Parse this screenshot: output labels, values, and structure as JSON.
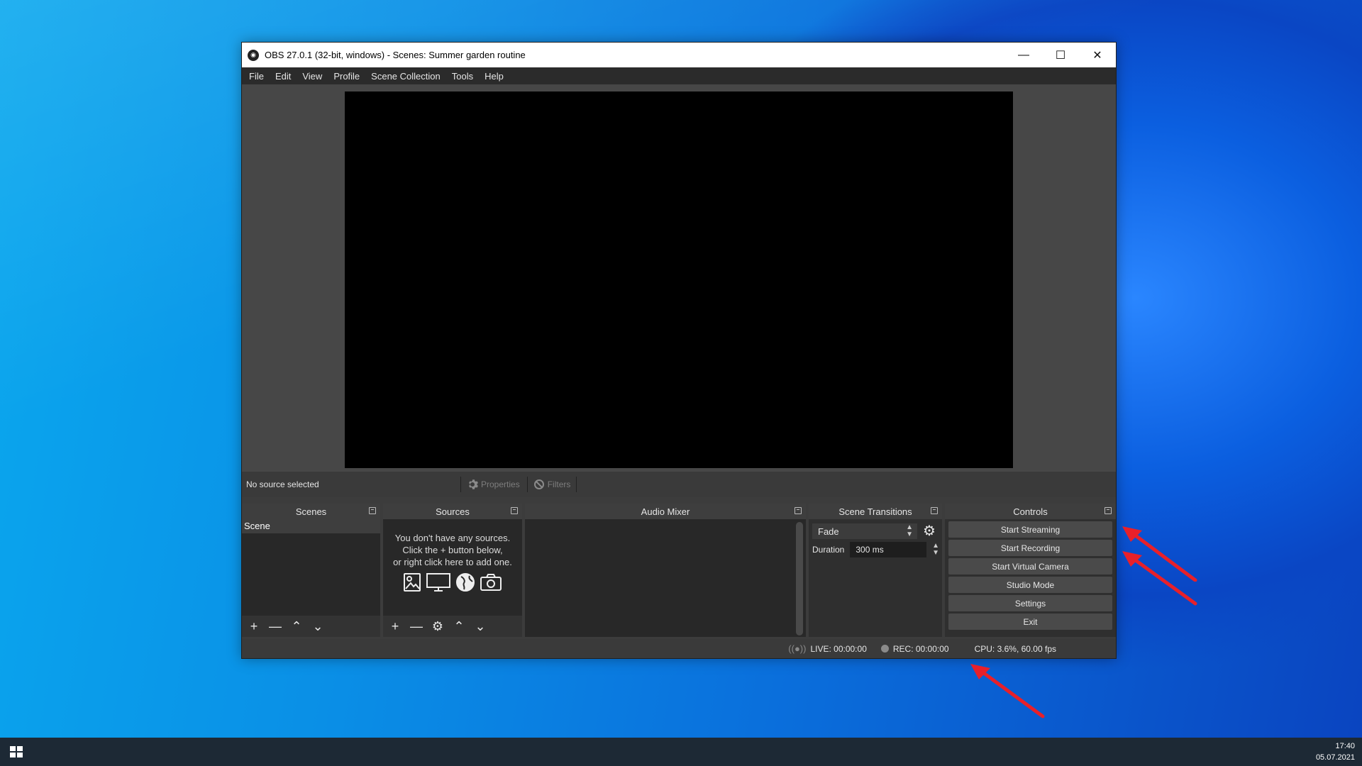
{
  "window": {
    "title": "OBS 27.0.1 (32-bit, windows) - Scenes: Summer garden routine",
    "icon": "obs-logo-icon"
  },
  "menu": [
    "File",
    "Edit",
    "View",
    "Profile",
    "Scene Collection",
    "Tools",
    "Help"
  ],
  "source_bar": {
    "status": "No source selected",
    "properties_label": "Properties",
    "filters_label": "Filters"
  },
  "docks": {
    "scenes": {
      "title": "Scenes",
      "items": [
        "Scene"
      ]
    },
    "sources": {
      "title": "Sources",
      "hint_line1": "You don't have any sources.",
      "hint_line2": "Click the + button below,",
      "hint_line3": "or right click here to add one."
    },
    "audio_mixer": {
      "title": "Audio Mixer"
    },
    "scene_transitions": {
      "title": "Scene Transitions",
      "transition": "Fade",
      "duration_label": "Duration",
      "duration_value": "300 ms"
    },
    "controls": {
      "title": "Controls",
      "buttons": [
        "Start Streaming",
        "Start Recording",
        "Start Virtual Camera",
        "Studio Mode",
        "Settings",
        "Exit"
      ]
    }
  },
  "status": {
    "live": "LIVE: 00:00:00",
    "rec": "REC: 00:00:00",
    "cpu": "CPU: 3.6%, 60.00 fps"
  },
  "taskbar": {
    "time": "17:40",
    "date": "05.07.2021"
  },
  "colors": {
    "annotation_arrow": "#e8202a",
    "panel_bg": "#282828"
  }
}
